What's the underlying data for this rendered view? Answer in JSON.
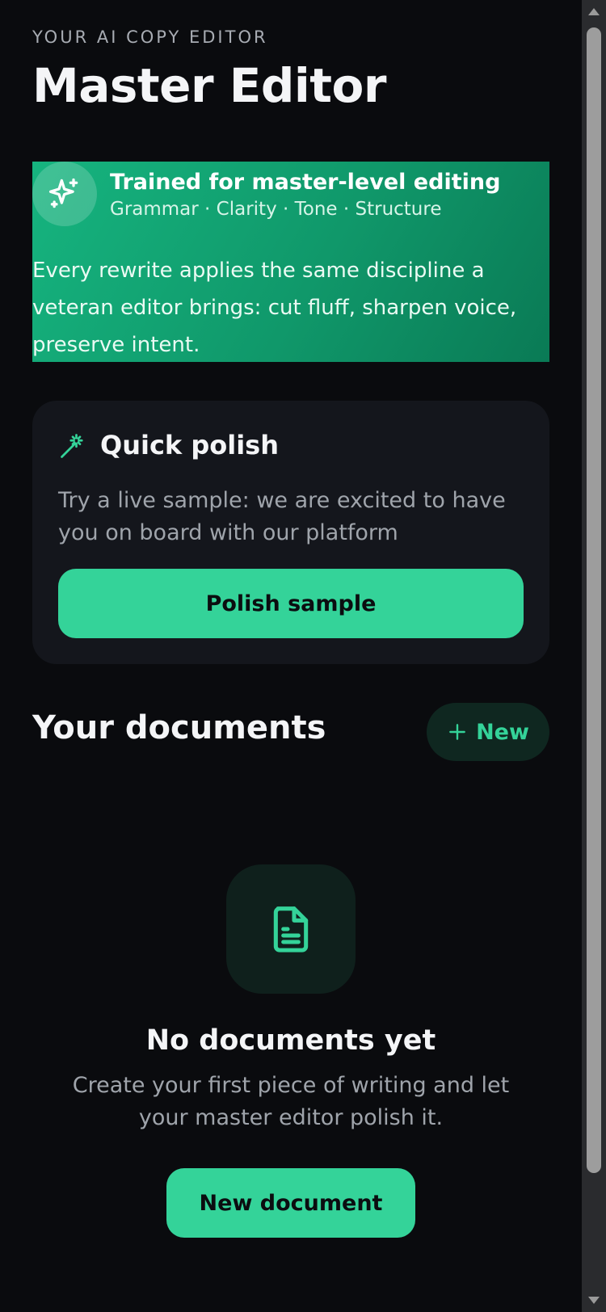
{
  "header": {
    "eyebrow": "YOUR AI COPY EDITOR",
    "title": "Master Editor"
  },
  "banner": {
    "icon": "sparkles-icon",
    "title": "Trained for master-level editing",
    "subtitle": "Grammar · Clarity · Tone · Structure",
    "body": "Every rewrite applies the same discipline a veteran editor brings: cut fluff, sharpen voice, preserve intent."
  },
  "quick_polish": {
    "icon": "magic-wand-icon",
    "title": "Quick polish",
    "text": "Try a live sample: we are excited to have you on board with our platform",
    "button_label": "Polish sample"
  },
  "documents": {
    "heading": "Your documents",
    "new_button_label": "New",
    "empty_state": {
      "icon": "document-icon",
      "title": "No documents yet",
      "text": "Create your first piece of writing and let your master editor polish it.",
      "button_label": "New document"
    }
  },
  "colors": {
    "accent": "#34d399",
    "background": "#0a0b0e",
    "card": "#14161c"
  }
}
